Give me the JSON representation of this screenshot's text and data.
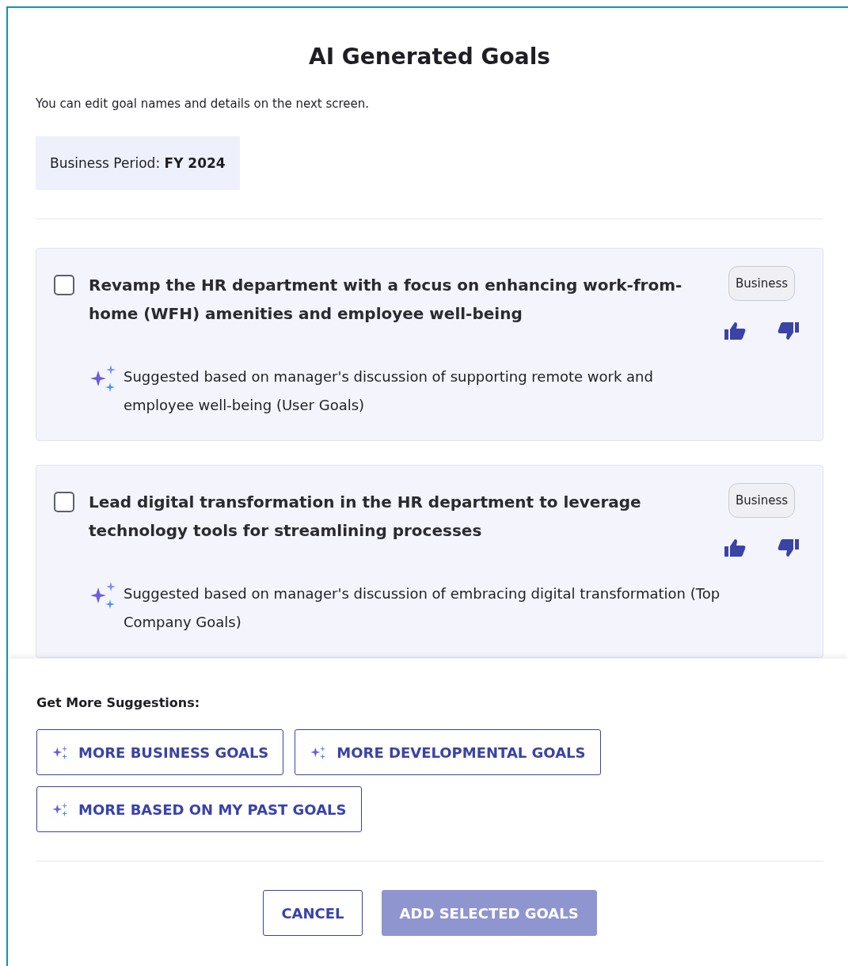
{
  "dialog": {
    "title": "AI Generated Goals",
    "subtitle": "You can edit goal names and details on the next screen.",
    "period": {
      "label": "Business Period:",
      "value": "FY 2024"
    }
  },
  "goals": [
    {
      "title": "Revamp the HR department with a focus on enhancing work-from-home (WFH) amenities and employee well-being",
      "checked": false,
      "tag": "Business",
      "reason": "Suggested based on manager's discussion of supporting remote work and employee well-being (User Goals)"
    },
    {
      "title": "Lead digital transformation in the HR department to leverage technology tools for streamlining processes",
      "checked": false,
      "tag": "Business",
      "reason": "Suggested based on manager's discussion of embracing digital transformation (Top Company Goals)"
    }
  ],
  "suggestions": {
    "heading": "Get More Suggestions:",
    "buttons": [
      "MORE BUSINESS GOALS",
      "MORE DEVELOPMENTAL GOALS",
      "MORE BASED ON MY PAST GOALS"
    ]
  },
  "footer": {
    "buttons": [
      {
        "label": "CANCEL",
        "kind": "secondary",
        "disabled": false
      },
      {
        "label": "ADD SELECTED GOALS",
        "kind": "primary",
        "disabled": true
      }
    ]
  }
}
